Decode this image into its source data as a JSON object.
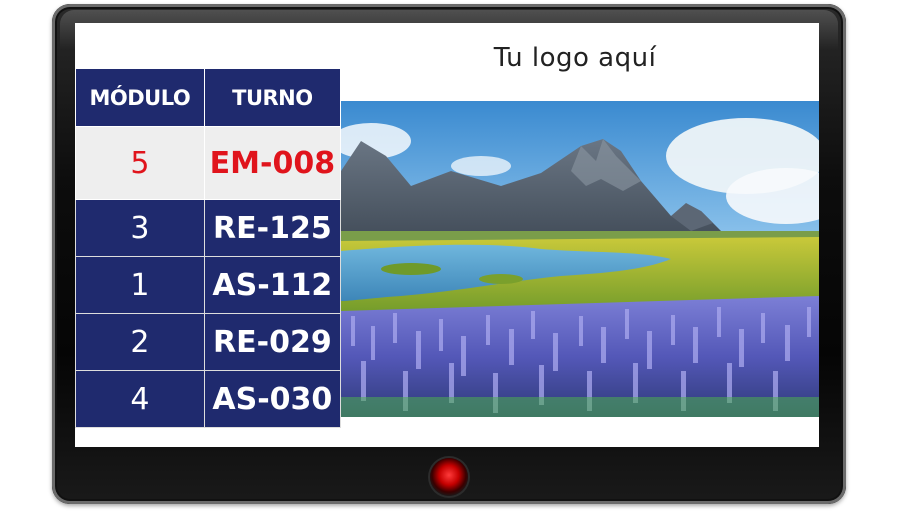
{
  "screen": {
    "logo_text": "Tu logo aquí"
  },
  "queue_table": {
    "headers": {
      "module": "MÓDULO",
      "turn": "TURNO"
    },
    "current": {
      "module": "5",
      "turn": "EM-008"
    },
    "rows": [
      {
        "module": "3",
        "turn": "RE-125"
      },
      {
        "module": "1",
        "turn": "AS-112"
      },
      {
        "module": "2",
        "turn": "RE-029"
      },
      {
        "module": "4",
        "turn": "AS-030"
      }
    ]
  },
  "colors": {
    "table_header_bg": "#1f2a6e",
    "table_row_bg": "#1f2a6e",
    "active_row_bg": "#eeeeee",
    "active_text": "#e0141c",
    "bezel": "#0d0d0d",
    "power_light": "#e0141c"
  },
  "icons": {
    "power_light": "power-light-icon"
  }
}
